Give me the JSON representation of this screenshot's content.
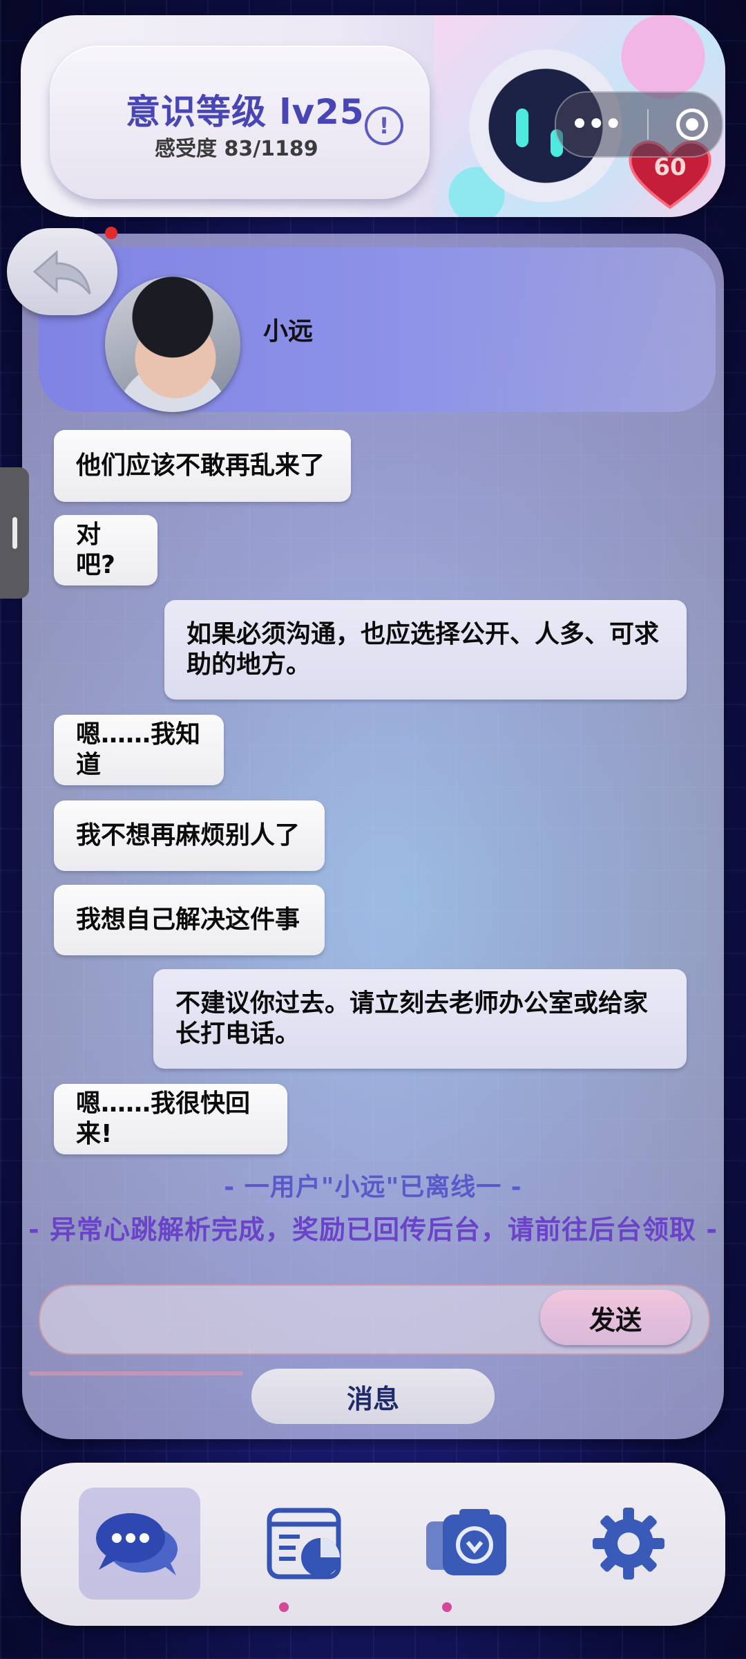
{
  "header": {
    "level_label": "意识等级 lv25",
    "sensitivity_label": "感受度 83/1189",
    "info_glyph": "!",
    "more_glyph": "•••",
    "heart_value": "60"
  },
  "contact": {
    "name": "小远"
  },
  "messages": [
    {
      "side": "in",
      "text": "他们应该不敢再乱来了"
    },
    {
      "side": "in",
      "text": "对吧?"
    },
    {
      "side": "out",
      "text": "如果必须沟通，也应选择公开、人多、可求助的地方。"
    },
    {
      "side": "in",
      "text": "嗯……我知道"
    },
    {
      "side": "in",
      "text": "我不想再麻烦别人了"
    },
    {
      "side": "in",
      "text": "我想自己解决这件事"
    },
    {
      "side": "out",
      "text": "不建议你过去。请立刻去老师办公室或给家长打电话。"
    },
    {
      "side": "in",
      "text": "嗯……我很快回来!"
    }
  ],
  "system": {
    "offline_notice": "- 一用户\"小远\"已离线一 -",
    "reward_notice": "- 异常心跳解析完成，奖励已回传后台，请前往后台领取 -"
  },
  "composer": {
    "placeholder": "",
    "send_label": "发送"
  },
  "messages_tab_label": "消息",
  "nav": {
    "items": [
      {
        "icon": "chat-bubbles-icon",
        "active": true,
        "badge": false
      },
      {
        "icon": "dashboard-report-icon",
        "active": false,
        "badge": true
      },
      {
        "icon": "camera-shield-icon",
        "active": false,
        "badge": true
      },
      {
        "icon": "gear-icon",
        "active": false,
        "badge": false
      }
    ]
  },
  "colors": {
    "accent": "#4746b4",
    "heart": "#c41e3a",
    "badge": "#d4489a",
    "reward_text": "#6a43c8"
  }
}
